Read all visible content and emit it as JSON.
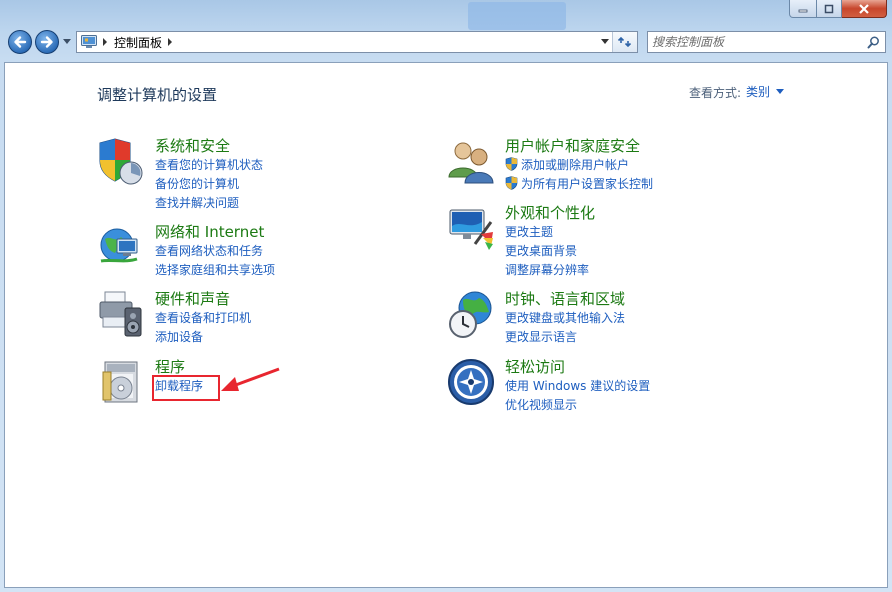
{
  "window": {
    "caption_buttons": {
      "minimize": "minimize",
      "maximize": "maximize",
      "close": "close"
    }
  },
  "nav": {
    "breadcrumb_root": "控制面板",
    "search_placeholder": "搜索控制面板"
  },
  "main": {
    "title": "调整计算机的设置",
    "view_by_label": "查看方式:",
    "view_by_value": "类别",
    "categories": [
      {
        "id": "system-security",
        "title": "系统和安全",
        "icon": "shield-icon",
        "links": [
          "查看您的计算机状态",
          "备份您的计算机",
          "查找并解决问题"
        ]
      },
      {
        "id": "network-internet",
        "title": "网络和 Internet",
        "icon": "network-globe-icon",
        "links": [
          "查看网络状态和任务",
          "选择家庭组和共享选项"
        ]
      },
      {
        "id": "hardware-sound",
        "title": "硬件和声音",
        "icon": "printer-speaker-icon",
        "links": [
          "查看设备和打印机",
          "添加设备"
        ]
      },
      {
        "id": "programs",
        "title": "程序",
        "icon": "programs-cd-icon",
        "links": [
          "卸载程序"
        ]
      },
      {
        "id": "user-accounts",
        "title": "用户帐户和家庭安全",
        "icon": "users-icon",
        "links": [
          "添加或删除用户帐户",
          "为所有用户设置家长控制"
        ]
      },
      {
        "id": "appearance",
        "title": "外观和个性化",
        "icon": "monitor-paint-icon",
        "links": [
          "更改主题",
          "更改桌面背景",
          "调整屏幕分辨率"
        ]
      },
      {
        "id": "clock-language",
        "title": "时钟、语言和区域",
        "icon": "globe-clock-icon",
        "links": [
          "更改键盘或其他输入法",
          "更改显示语言"
        ]
      },
      {
        "id": "ease-of-access",
        "title": "轻松访问",
        "icon": "ease-of-access-icon",
        "links": [
          "使用 Windows 建议的设置",
          "优化视频显示"
        ]
      }
    ]
  },
  "colors": {
    "category_title": "#1c7a13",
    "link": "#1e5ebf",
    "highlight": "#e8262f"
  }
}
